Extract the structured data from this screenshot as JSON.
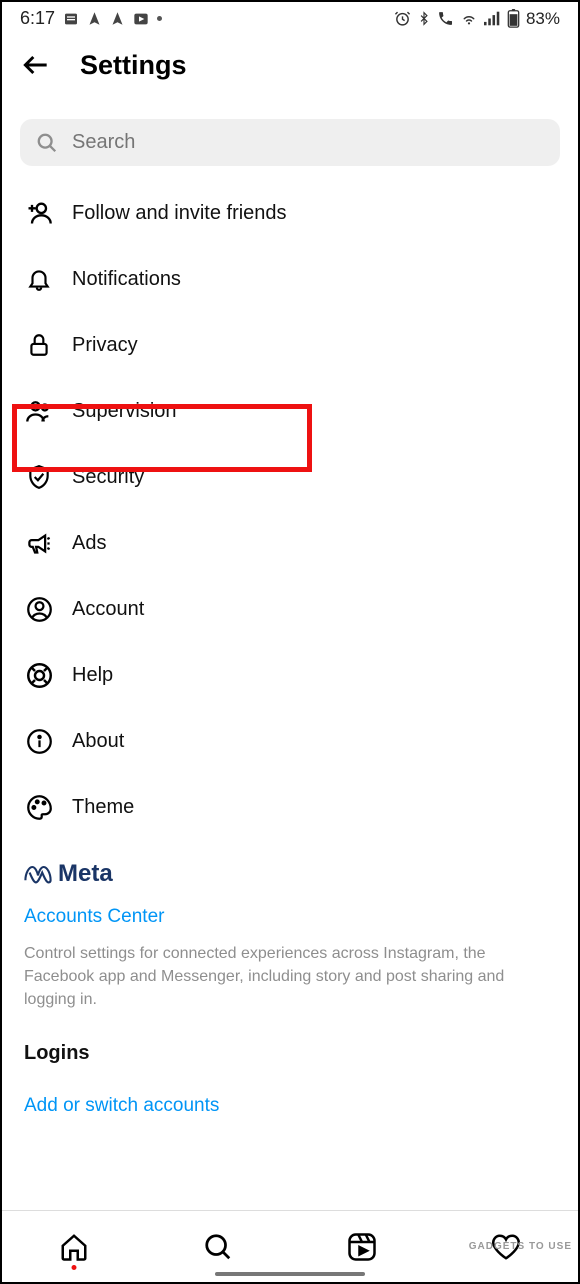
{
  "status": {
    "time": "6:17",
    "battery": "83%"
  },
  "header": {
    "title": "Settings"
  },
  "search": {
    "placeholder": "Search"
  },
  "items": [
    {
      "label": "Follow and invite friends"
    },
    {
      "label": "Notifications"
    },
    {
      "label": "Privacy"
    },
    {
      "label": "Supervision"
    },
    {
      "label": "Security"
    },
    {
      "label": "Ads"
    },
    {
      "label": "Account"
    },
    {
      "label": "Help"
    },
    {
      "label": "About"
    },
    {
      "label": "Theme"
    }
  ],
  "meta": {
    "brand": "Meta",
    "link": "Accounts Center",
    "desc": "Control settings for connected experiences across Instagram, the Facebook app and Messenger, including story and post sharing and logging in."
  },
  "logins": {
    "title": "Logins",
    "link": "Add or switch accounts"
  },
  "watermark": "GADGETS TO USE"
}
